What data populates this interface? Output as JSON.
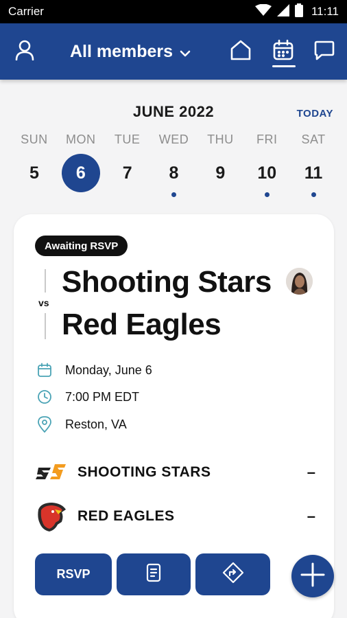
{
  "status_bar": {
    "carrier": "Carrier",
    "time": "11:11"
  },
  "header": {
    "member_filter": "All members",
    "icons": [
      "person-icon",
      "chevron-down-icon",
      "home-icon",
      "calendar-icon",
      "chat-icon"
    ]
  },
  "calendar": {
    "month": "JUNE 2022",
    "today_label": "TODAY",
    "days": [
      {
        "dow": "SUN",
        "date": "5",
        "selected": false,
        "has_event": false
      },
      {
        "dow": "MON",
        "date": "6",
        "selected": true,
        "has_event": false
      },
      {
        "dow": "TUE",
        "date": "7",
        "selected": false,
        "has_event": false
      },
      {
        "dow": "WED",
        "date": "8",
        "selected": false,
        "has_event": true
      },
      {
        "dow": "THU",
        "date": "9",
        "selected": false,
        "has_event": false
      },
      {
        "dow": "FRI",
        "date": "10",
        "selected": false,
        "has_event": true
      },
      {
        "dow": "SAT",
        "date": "11",
        "selected": false,
        "has_event": true
      }
    ]
  },
  "event": {
    "status_badge": "Awaiting RSVP",
    "vs_label": "vs",
    "home_team": "Shooting Stars",
    "away_team": "Red Eagles",
    "date": "Monday, June 6",
    "time": "7:00 PM EDT",
    "location": "Reston, VA",
    "teams": [
      {
        "name": "SHOOTING STARS",
        "score": "–",
        "logo": "shooting-stars-logo"
      },
      {
        "name": "RED EAGLES",
        "score": "–",
        "logo": "red-eagles-logo"
      }
    ],
    "actions": {
      "rsvp_label": "RSVP",
      "notes_icon": "document-icon",
      "directions_icon": "directions-icon"
    },
    "fab_icon": "plus-icon"
  },
  "colors": {
    "brand": "#1f4690",
    "status_bar": "#000000",
    "background": "#f4f4f5",
    "accent_icon": "#4aa3b5"
  }
}
